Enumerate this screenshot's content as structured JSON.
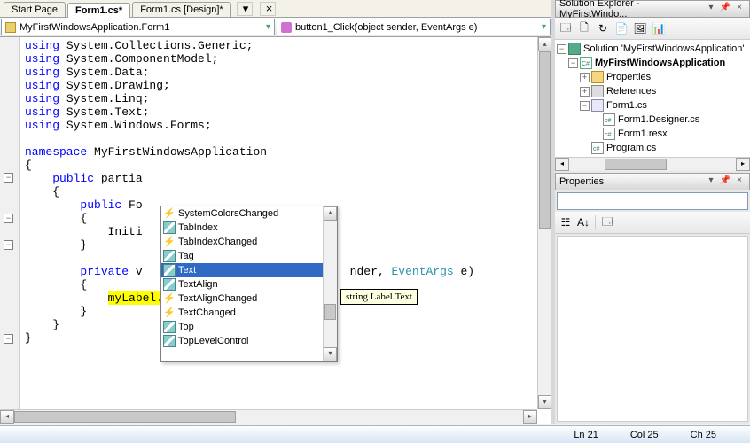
{
  "tabs": {
    "start": "Start Page",
    "form_cs": "Form1.cs*",
    "form_design": "Form1.cs [Design]*"
  },
  "dropdowns": {
    "class": "MyFirstWindowsApplication.Form1",
    "member": "button1_Click(object sender, EventArgs e)"
  },
  "code": {
    "usings": [
      "System.Collections.Generic",
      "System.ComponentModel",
      "System.Data",
      "System.Drawing",
      "System.Linq",
      "System.Text",
      "System.Windows.Forms"
    ],
    "namespace_kw": "namespace",
    "namespace_name": " MyFirstWindowsApplication",
    "public_partial": "public",
    "partial_word": " partia",
    "public_fo": "public",
    "fo_word": " Fo",
    "initi": "Initi",
    "private_v": "private",
    "v_word": " v",
    "nder": "nder, ",
    "eventargs": "EventArgs",
    "e_paren": " e)",
    "highlighted": "myLabel.Text"
  },
  "intellisense": {
    "items": [
      {
        "icon": "event",
        "label": "SystemColorsChanged"
      },
      {
        "icon": "prop",
        "label": "TabIndex"
      },
      {
        "icon": "event",
        "label": "TabIndexChanged"
      },
      {
        "icon": "prop",
        "label": "Tag"
      },
      {
        "icon": "prop",
        "label": "Text",
        "selected": true
      },
      {
        "icon": "prop",
        "label": "TextAlign"
      },
      {
        "icon": "event",
        "label": "TextAlignChanged"
      },
      {
        "icon": "event",
        "label": "TextChanged"
      },
      {
        "icon": "prop",
        "label": "Top"
      },
      {
        "icon": "prop",
        "label": "TopLevelControl"
      }
    ],
    "tooltip": "string Label.Text"
  },
  "solution_explorer": {
    "title": "Solution Explorer - MyFirstWindo...",
    "root": "Solution 'MyFirstWindowsApplication'",
    "project": "MyFirstWindowsApplication",
    "properties": "Properties",
    "references": "References",
    "form_cs": "Form1.cs",
    "form_designer": "Form1.Designer.cs",
    "form_resx": "Form1.resx",
    "program_cs": "Program.cs"
  },
  "properties": {
    "title": "Properties"
  },
  "status": {
    "ln": "Ln 21",
    "col": "Col 25",
    "ch": "Ch 25"
  }
}
